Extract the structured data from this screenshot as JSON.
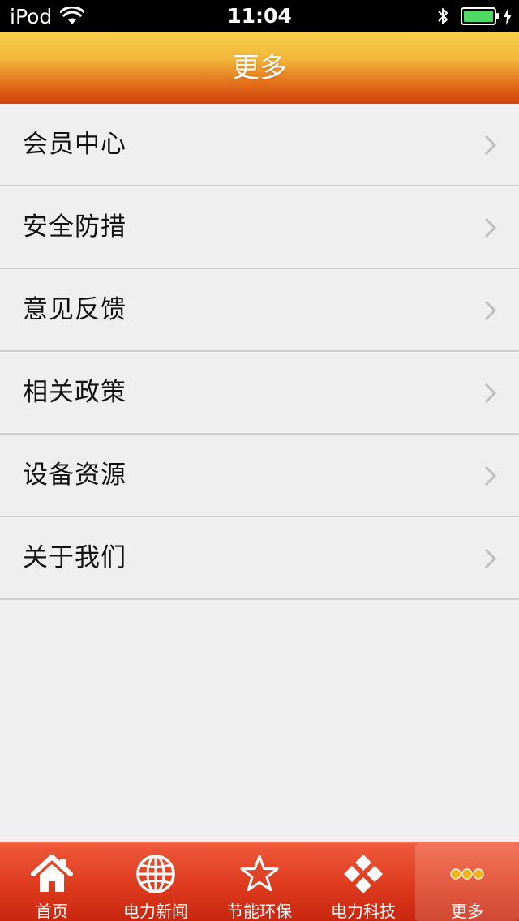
{
  "status_bar": {
    "carrier": "iPod",
    "time": "11:04"
  },
  "nav": {
    "title": "更多"
  },
  "menu": {
    "items": [
      {
        "label": "会员中心"
      },
      {
        "label": "安全防措"
      },
      {
        "label": "意见反馈"
      },
      {
        "label": "相关政策"
      },
      {
        "label": "设备资源"
      },
      {
        "label": "关于我们"
      }
    ]
  },
  "tab_bar": {
    "tabs": [
      {
        "label": "首页",
        "icon": "home-icon"
      },
      {
        "label": "电力新闻",
        "icon": "globe-icon"
      },
      {
        "label": "节能环保",
        "icon": "star-icon"
      },
      {
        "label": "电力科技",
        "icon": "diamond-grid-icon"
      },
      {
        "label": "更多",
        "icon": "more-dots-icon",
        "active": true
      }
    ]
  },
  "colors": {
    "nav_gradient_top": "#f7cf47",
    "nav_gradient_bottom": "#d1410d",
    "tab_bar": "#de3b1e",
    "more_dots": "#f2b31a",
    "list_background": "#efefef",
    "battery": "#4cd964"
  }
}
